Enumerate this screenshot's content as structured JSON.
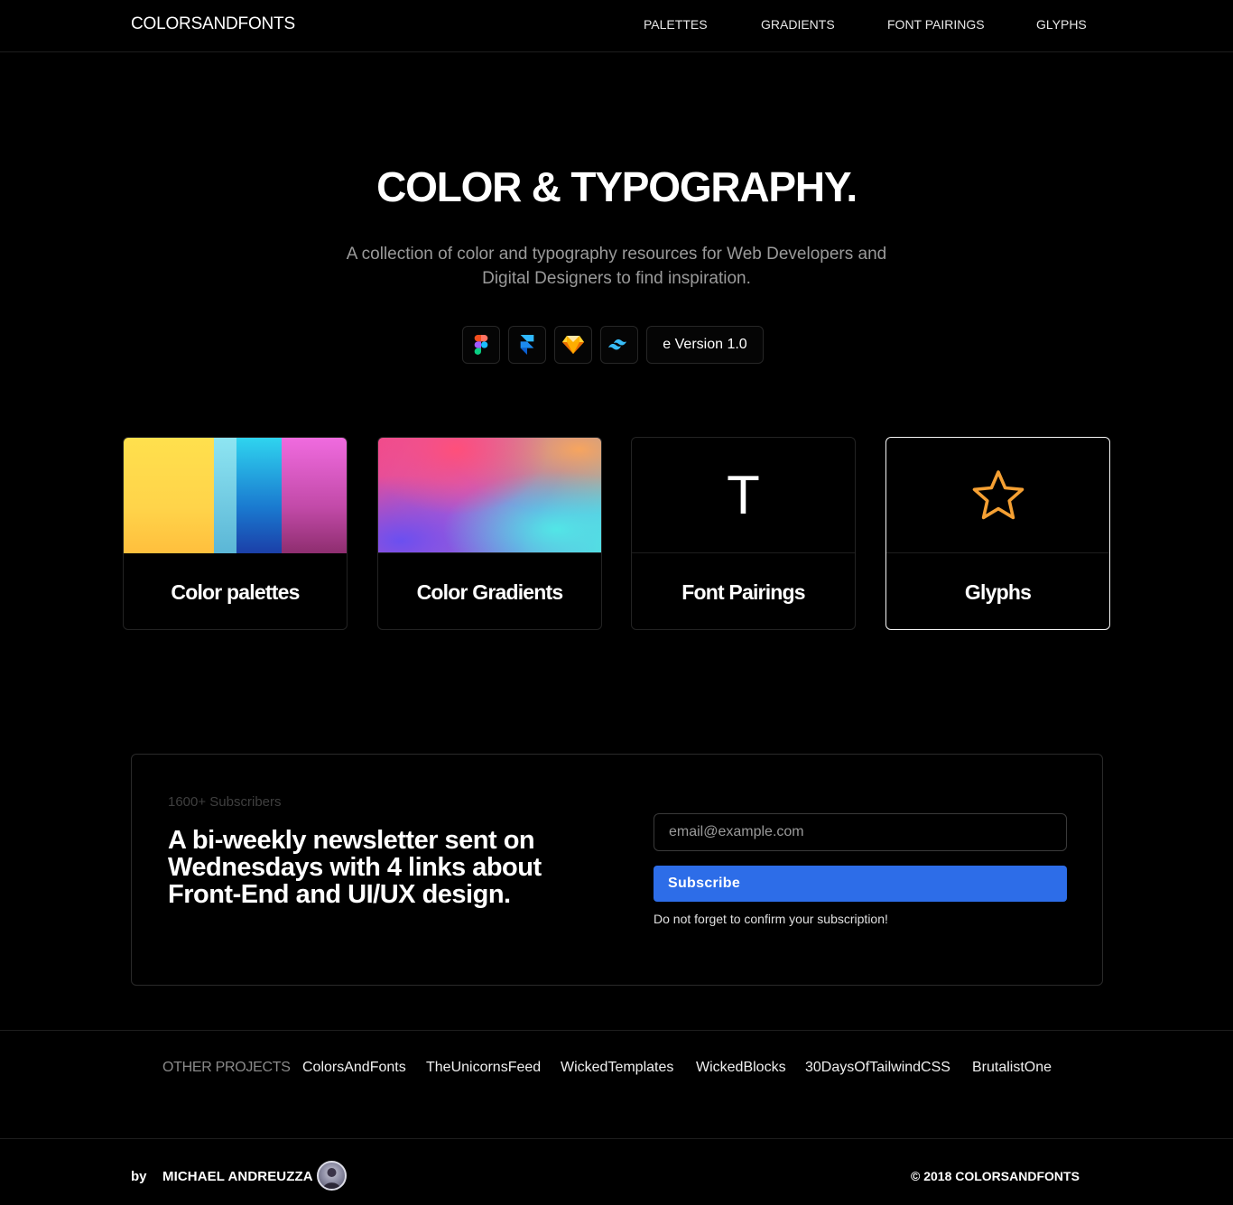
{
  "nav": {
    "brand": "COLORSANDFONTS",
    "links": [
      "PALETTES",
      "GRADIENTS",
      "FONT PAIRINGS",
      "GLYPHS"
    ]
  },
  "hero": {
    "title": "COLOR & TYPOGRAPHY.",
    "subtitle": "A collection of color and typography resources for Web Developers and Digital Designers to find inspiration.",
    "tool_icons": [
      "figma-icon",
      "framer-icon",
      "sketch-icon",
      "tailwind-icon"
    ],
    "version_label": "e Version 1.0"
  },
  "cards": [
    {
      "label": "Color palettes",
      "art": "palette-swatches"
    },
    {
      "label": "Color Gradients",
      "art": "gradient-blend"
    },
    {
      "label": "Font Pairings",
      "art": "T"
    },
    {
      "label": "Glyphs",
      "art": "star-icon"
    }
  ],
  "palette_colors": [
    "#ffd84d",
    "#7fd3e6",
    "#1d8fd6",
    "#e25fc8"
  ],
  "newsletter": {
    "subscribers": "1600+ Subscribers",
    "headline": "A bi-weekly newsletter sent on Wednesdays with 4 links about Front-End and UI/UX design.",
    "email_placeholder": "email@example.com",
    "button_label": "Subscribe",
    "note": "Do not forget to confirm your subscription!"
  },
  "projects": {
    "label": "OTHER PROJECTS",
    "links": [
      "ColorsAndFonts",
      "TheUnicornsFeed",
      "WickedTemplates",
      "WickedBlocks",
      "30DaysOfTailwindCSS",
      "BrutalistOne"
    ]
  },
  "footer": {
    "by": "by",
    "author": "MICHAEL ANDREUZZA",
    "copyright": "© 2018 COLORSANDFONTS"
  },
  "colors": {
    "background": "#000000",
    "accent_button": "#2d6de8",
    "star": "#f5a033"
  }
}
